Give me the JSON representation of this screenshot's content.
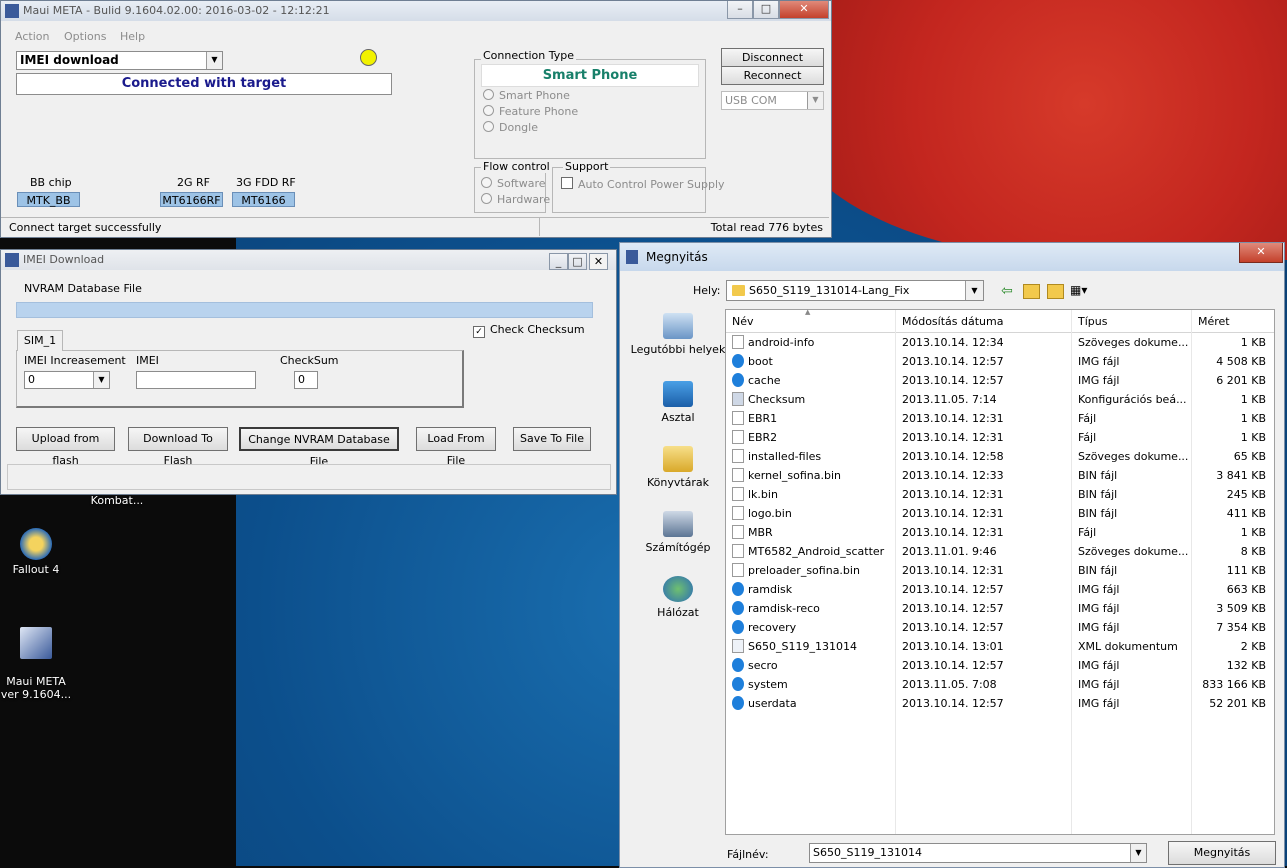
{
  "desktop": {
    "icons": [
      {
        "label": "Kombat..."
      },
      {
        "label": "Fallout 4"
      },
      {
        "label": "Maui META\nver 9.1604..."
      }
    ]
  },
  "meta_window": {
    "title": "Maui META - Bulid 9.1604.02.00: 2016-03-02 - 12:12:21",
    "menu": [
      "Action",
      "Options",
      "Help"
    ],
    "mode_select": "IMEI download",
    "status_banner": "Connected with target",
    "connection_type": {
      "group_label": "Connection Type",
      "selected_label": "Smart Phone",
      "options": [
        "Smart Phone",
        "Feature Phone",
        "Dongle"
      ]
    },
    "buttons": {
      "disconnect": "Disconnect",
      "reconnect": "Reconnect"
    },
    "port_select": "USB COM",
    "flow_control": {
      "group_label": "Flow control",
      "options": [
        "Software",
        "Hardware"
      ]
    },
    "support": {
      "group_label": "Support",
      "checkbox_label": "Auto Control Power Supply"
    },
    "chips": {
      "bb_label": "BB chip",
      "bb_value": "MTK_BB",
      "rf2g_label": "2G RF",
      "rf2g_value": "MT6166RF",
      "rf3g_label": "3G FDD RF",
      "rf3g_value": "MT6166"
    },
    "statusbar": {
      "left": "Connect target successfully",
      "right": "Total read 776 bytes"
    },
    "indicator_color": "#f2f200"
  },
  "imei_window": {
    "title": "IMEI Download",
    "nvram_label": "NVRAM Database File",
    "check_checksum": "Check Checksum",
    "tab": "SIM_1",
    "imei_increase_label": "IMEI Increasement",
    "imei_increase_value": "0",
    "imei_label": "IMEI",
    "imei_value": "",
    "checksum_label": "CheckSum",
    "checksum_value": "0",
    "buttons": {
      "upload": "Upload from flash",
      "download": "Download To Flash",
      "change_db": "Change NVRAM Database File",
      "load_file": "Load From File",
      "save_file": "Save To File"
    }
  },
  "open_dialog": {
    "title": "Megnyitás",
    "location_label": "Hely:",
    "location_value": "S650_S119_131014-Lang_Fix",
    "sidebar": [
      "Legutóbbi helyek",
      "Asztal",
      "Könyvtárak",
      "Számítógép",
      "Hálózat"
    ],
    "columns": [
      "Név",
      "Módosítás dátuma",
      "Típus",
      "Méret"
    ],
    "files": [
      {
        "name": "android-info",
        "date": "2013.10.14. 12:34",
        "type": "Szöveges dokume...",
        "size": "1 KB",
        "icon": "doc"
      },
      {
        "name": "boot",
        "date": "2013.10.14. 12:57",
        "type": "IMG fájl",
        "size": "4 508 KB",
        "icon": "img"
      },
      {
        "name": "cache",
        "date": "2013.10.14. 12:57",
        "type": "IMG fájl",
        "size": "6 201 KB",
        "icon": "img"
      },
      {
        "name": "Checksum",
        "date": "2013.11.05. 7:14",
        "type": "Konfigurációs beá...",
        "size": "1 KB",
        "icon": "cfg"
      },
      {
        "name": "EBR1",
        "date": "2013.10.14. 12:31",
        "type": "Fájl",
        "size": "1 KB",
        "icon": "doc"
      },
      {
        "name": "EBR2",
        "date": "2013.10.14. 12:31",
        "type": "Fájl",
        "size": "1 KB",
        "icon": "doc"
      },
      {
        "name": "installed-files",
        "date": "2013.10.14. 12:58",
        "type": "Szöveges dokume...",
        "size": "65 KB",
        "icon": "doc"
      },
      {
        "name": "kernel_sofina.bin",
        "date": "2013.10.14. 12:33",
        "type": "BIN fájl",
        "size": "3 841 KB",
        "icon": "doc"
      },
      {
        "name": "lk.bin",
        "date": "2013.10.14. 12:31",
        "type": "BIN fájl",
        "size": "245 KB",
        "icon": "doc"
      },
      {
        "name": "logo.bin",
        "date": "2013.10.14. 12:31",
        "type": "BIN fájl",
        "size": "411 KB",
        "icon": "doc"
      },
      {
        "name": "MBR",
        "date": "2013.10.14. 12:31",
        "type": "Fájl",
        "size": "1 KB",
        "icon": "doc"
      },
      {
        "name": "MT6582_Android_scatter",
        "date": "2013.11.01. 9:46",
        "type": "Szöveges dokume...",
        "size": "8 KB",
        "icon": "doc"
      },
      {
        "name": "preloader_sofina.bin",
        "date": "2013.10.14. 12:31",
        "type": "BIN fájl",
        "size": "111 KB",
        "icon": "doc"
      },
      {
        "name": "ramdisk",
        "date": "2013.10.14. 12:57",
        "type": "IMG fájl",
        "size": "663 KB",
        "icon": "img"
      },
      {
        "name": "ramdisk-reco",
        "date": "2013.10.14. 12:57",
        "type": "IMG fájl",
        "size": "3 509 KB",
        "icon": "img"
      },
      {
        "name": "recovery",
        "date": "2013.10.14. 12:57",
        "type": "IMG fájl",
        "size": "7 354 KB",
        "icon": "img"
      },
      {
        "name": "S650_S119_131014",
        "date": "2013.10.14. 13:01",
        "type": "XML dokumentum",
        "size": "2 KB",
        "icon": "xml"
      },
      {
        "name": "secro",
        "date": "2013.10.14. 12:57",
        "type": "IMG fájl",
        "size": "132 KB",
        "icon": "img"
      },
      {
        "name": "system",
        "date": "2013.11.05. 7:08",
        "type": "IMG fájl",
        "size": "833 166 KB",
        "icon": "img"
      },
      {
        "name": "userdata",
        "date": "2013.10.14. 12:57",
        "type": "IMG fájl",
        "size": "52 201 KB",
        "icon": "img"
      }
    ],
    "filename_label": "Fájlnév:",
    "filename_value": "S650_S119_131014",
    "open_button": "Megnyitás"
  }
}
